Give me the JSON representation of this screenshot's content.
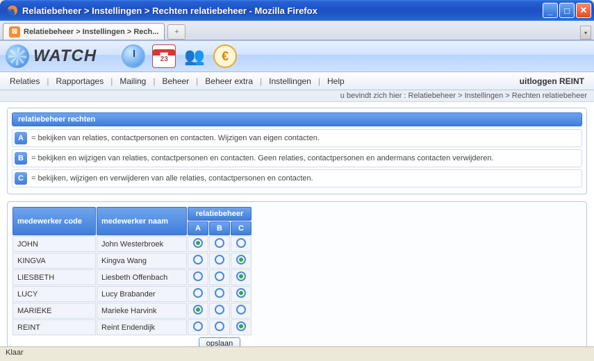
{
  "window": {
    "title": "Relatiebeheer  > Instellingen > Rechten relatiebeheer - Mozilla Firefox",
    "tab_label": "Relatiebeheer > Instellingen > Rech...",
    "status": "Klaar"
  },
  "banner": {
    "app_name": "WATCH",
    "cal_day": "23"
  },
  "nav": {
    "items": [
      "Relaties",
      "Rapportages",
      "Mailing",
      "Beheer",
      "Beheer extra",
      "Instellingen",
      "Help"
    ],
    "logout": "uitloggen REINT"
  },
  "breadcrumb": {
    "prefix": "u bevindt zich hier : ",
    "path": "Relatiebeheer > Instellingen > Rechten relatiebeheer"
  },
  "legend": {
    "title": "relatiebeheer rechten",
    "rows": [
      {
        "badge": "A",
        "text": "= bekijken van relaties, contactpersonen en contacten. Wijzigen van eigen contacten."
      },
      {
        "badge": "B",
        "text": "= bekijken en wijzigen van relaties, contactpersonen en contacten. Geen relaties, contactpersonen en andermans contacten verwijderen."
      },
      {
        "badge": "C",
        "text": "= bekijken, wijzigen en verwijderen van alle relaties, contactpersonen en contacten."
      }
    ]
  },
  "table": {
    "group_header": "relatiebeheer",
    "col_code": "medewerker code",
    "col_name": "medewerker naam",
    "col_a": "A",
    "col_b": "B",
    "col_c": "C",
    "rows": [
      {
        "code": "JOHN",
        "name": "John Westerbroek",
        "sel": "A"
      },
      {
        "code": "KINGVA",
        "name": "Kingva Wang",
        "sel": "C"
      },
      {
        "code": "LIESBETH",
        "name": "Liesbeth Offenbach",
        "sel": "C"
      },
      {
        "code": "LUCY",
        "name": "Lucy Brabander",
        "sel": "C"
      },
      {
        "code": "MARIEKE",
        "name": "Marieke Harvink",
        "sel": "A"
      },
      {
        "code": "REINT",
        "name": "Reint Endendijk",
        "sel": "C"
      }
    ],
    "save": "opslaan"
  }
}
